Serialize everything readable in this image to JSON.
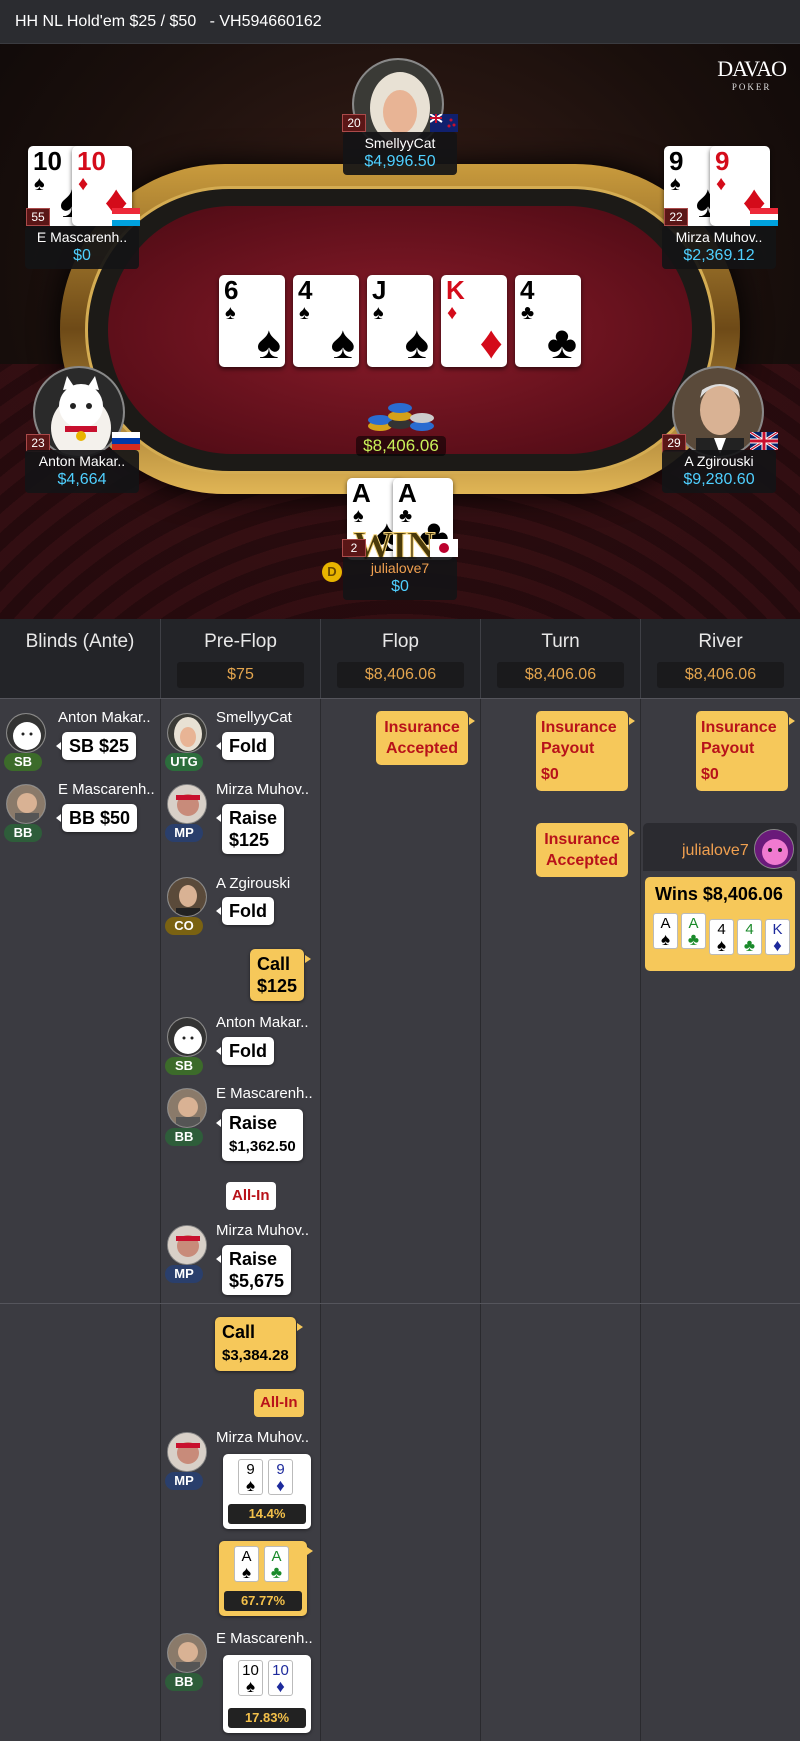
{
  "title": "HH NL Hold'em $25 / $50",
  "hand_id": "- VH594660162",
  "logo": {
    "line1": "DAVAO",
    "line2": "POKER"
  },
  "board": [
    {
      "rank": "6",
      "suit": "♠",
      "color": "black"
    },
    {
      "rank": "4",
      "suit": "♠",
      "color": "black"
    },
    {
      "rank": "J",
      "suit": "♠",
      "color": "black"
    },
    {
      "rank": "K",
      "suit": "♦",
      "color": "red"
    },
    {
      "rank": "4",
      "suit": "♣",
      "color": "black"
    }
  ],
  "pot": "$8,406.06",
  "win_label": "WIN",
  "seats": {
    "top": {
      "name": "SmellyyCat",
      "stack": "$4,996.50",
      "level": "20",
      "flag": "nz"
    },
    "top_left": {
      "name": "E Mascarenh..",
      "stack": "$0",
      "level": "55",
      "flag": "lu",
      "cards": [
        {
          "rank": "10",
          "suit": "♠",
          "color": "black"
        },
        {
          "rank": "10",
          "suit": "♦",
          "color": "red"
        }
      ]
    },
    "top_right": {
      "name": "Mirza Muhov..",
      "stack": "$2,369.12",
      "level": "22",
      "flag": "lu",
      "cards": [
        {
          "rank": "9",
          "suit": "♠",
          "color": "black"
        },
        {
          "rank": "9",
          "suit": "♦",
          "color": "red"
        }
      ]
    },
    "left": {
      "name": "Anton Makar..",
      "stack": "$4,664",
      "level": "23",
      "flag": "ru"
    },
    "right": {
      "name": "A Zgirouski",
      "stack": "$9,280.60",
      "level": "29",
      "flag": "gb"
    },
    "bottom": {
      "name": "julialove7",
      "stack": "$0",
      "level": "2",
      "flag": "jp",
      "cards": [
        {
          "rank": "A",
          "suit": "♠",
          "color": "black"
        },
        {
          "rank": "A",
          "suit": "♣",
          "color": "black"
        }
      ]
    }
  },
  "dealer_label": "D",
  "columns": [
    {
      "title": "Blinds (Ante)",
      "pot": ""
    },
    {
      "title": "Pre-Flop",
      "pot": "$75"
    },
    {
      "title": "Flop",
      "pot": "$8,406.06"
    },
    {
      "title": "Turn",
      "pot": "$8,406.06"
    },
    {
      "title": "River",
      "pot": "$8,406.06"
    }
  ],
  "blinds": [
    {
      "name": "Anton Makar..",
      "pos": "SB",
      "action": "SB $25"
    },
    {
      "name": "E Mascarenh..",
      "pos": "BB",
      "action": "BB $50"
    }
  ],
  "preflop": {
    "a1": {
      "name": "SmellyyCat",
      "pos": "UTG",
      "action": "Fold"
    },
    "a2": {
      "name": "Mirza Muhov..",
      "pos": "MP",
      "action": "Raise",
      "amount": "$125"
    },
    "a3": {
      "name": "A Zgirouski",
      "pos": "CO",
      "action": "Fold"
    },
    "a4": {
      "action": "Call",
      "amount": "$125"
    },
    "a5": {
      "name": "Anton Makar..",
      "pos": "SB",
      "action": "Fold"
    },
    "a6": {
      "name": "E Mascarenh..",
      "pos": "BB",
      "action": "Raise",
      "amount": "$1,362.50",
      "allin": "All-In"
    },
    "a7": {
      "name": "Mirza Muhov..",
      "pos": "MP",
      "action": "Raise",
      "amount": "$5,675"
    },
    "a8": {
      "action": "Call",
      "amount": "$3,384.28",
      "allin": "All-In"
    },
    "eq1": {
      "name": "Mirza Muhov..",
      "pos": "MP",
      "c1": "9",
      "c2": "9",
      "equity": "14.4%"
    },
    "eq2": {
      "c1": "A",
      "c2": "A",
      "equity": "67.77%"
    },
    "eq3": {
      "name": "E Mascarenh..",
      "pos": "BB",
      "c1": "10",
      "c2": "10",
      "equity": "17.83%"
    }
  },
  "flop": {
    "ins1": "Insurance Accepted"
  },
  "turn": {
    "ins_payout_label": "Insurance Payout",
    "ins_payout_amount": "$0",
    "ins2": "Insurance Accepted"
  },
  "river": {
    "ins_payout_label": "Insurance Payout",
    "ins_payout_amount": "$0",
    "winner": "julialove7",
    "wins": "Wins $8,406.06",
    "cards": [
      "A",
      "A",
      "4",
      "4",
      "K"
    ]
  }
}
